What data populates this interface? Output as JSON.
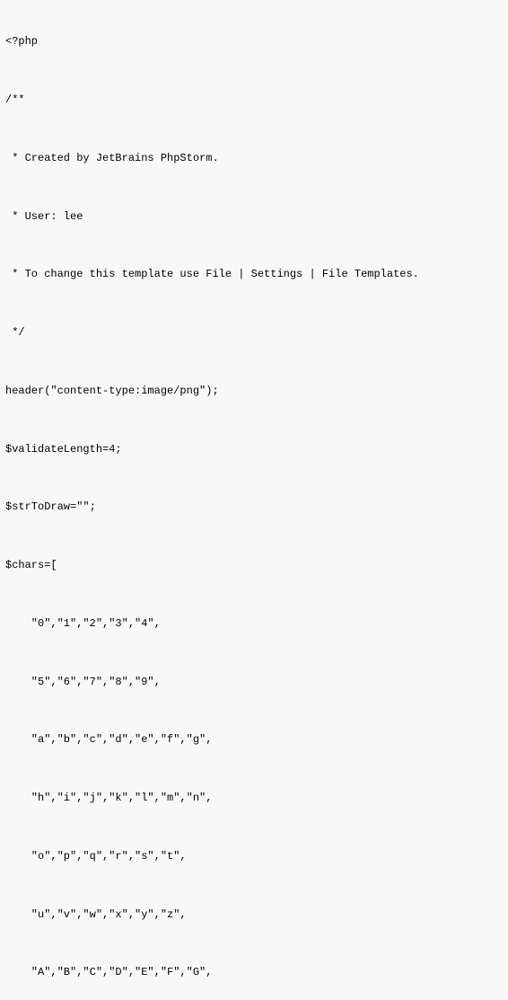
{
  "code": {
    "lines": [
      "<?php",
      "",
      "/**",
      "",
      " * Created by JetBrains PhpStorm.",
      "",
      " * User: lee",
      "",
      " * To change this template use File | Settings | File Templates.",
      "",
      " */",
      "",
      "header(\"content-type:image/png\");",
      "",
      "$validateLength=4;",
      "",
      "$strToDraw=\"\";",
      "",
      "$chars=[",
      "",
      "    \"0\",\"1\",\"2\",\"3\",\"4\",",
      "",
      "    \"5\",\"6\",\"7\",\"8\",\"9\",",
      "",
      "    \"a\",\"b\",\"c\",\"d\",\"e\",\"f\",\"g\",",
      "",
      "    \"h\",\"i\",\"j\",\"k\",\"l\",\"m\",\"n\",",
      "",
      "    \"o\",\"p\",\"q\",\"r\",\"s\",\"t\",",
      "",
      "    \"u\",\"v\",\"w\",\"x\",\"y\",\"z\",",
      "",
      "    \"A\",\"B\",\"C\",\"D\",\"E\",\"F\",\"G\","
    ]
  }
}
